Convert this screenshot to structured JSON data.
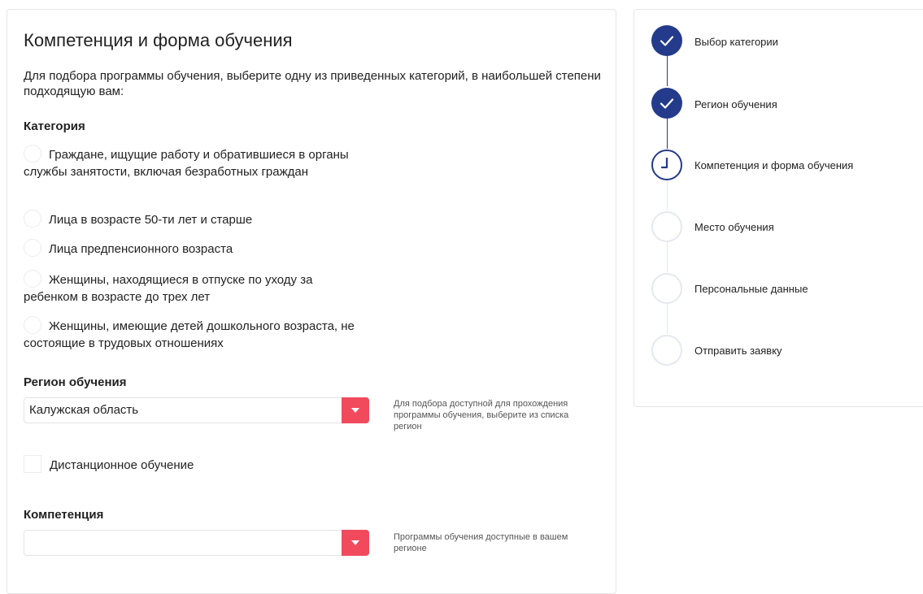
{
  "form": {
    "title": "Компетенция и форма обучения",
    "intro": "Для подбора программы обучения, выберите одну из приведенных категорий, в наибольшей степени подходящую вам:",
    "category_label": "Категория",
    "categories": [
      "Граждане, ищущие работу и обратившиеся в органы службы занятости, включая безработных граждан",
      "Лица в возрасте 50-ти лет и старше",
      "Лица предпенсионного возраста",
      "Женщины, находящиеся в отпуске по уходу за ребенком в возрасте до трех лет",
      "Женщины, имеющие детей дошкольного возраста, не состоящие в трудовых отношениях"
    ],
    "region_label": "Регион обучения",
    "region_value": "Калужская область",
    "region_hint": "Для подбора доступной для прохождения программы обучения, выберите из списка регион",
    "distance_label": "Дистанционное обучение",
    "competence_label": "Компетенция",
    "competence_value": "",
    "competence_hint": "Программы обучения доступные в вашем регионе"
  },
  "steps": [
    {
      "label": "Выбор категории",
      "state": "done"
    },
    {
      "label": "Регион обучения",
      "state": "done"
    },
    {
      "label": "Компетенция и форма обучения",
      "state": "current"
    },
    {
      "label": "Место обучения",
      "state": "todo"
    },
    {
      "label": "Персональные данные",
      "state": "todo"
    },
    {
      "label": "Отправить заявку",
      "state": "todo"
    }
  ],
  "colors": {
    "primary": "#243b8c",
    "accent": "#f24a5d",
    "inactive": "#e5e8ee"
  }
}
